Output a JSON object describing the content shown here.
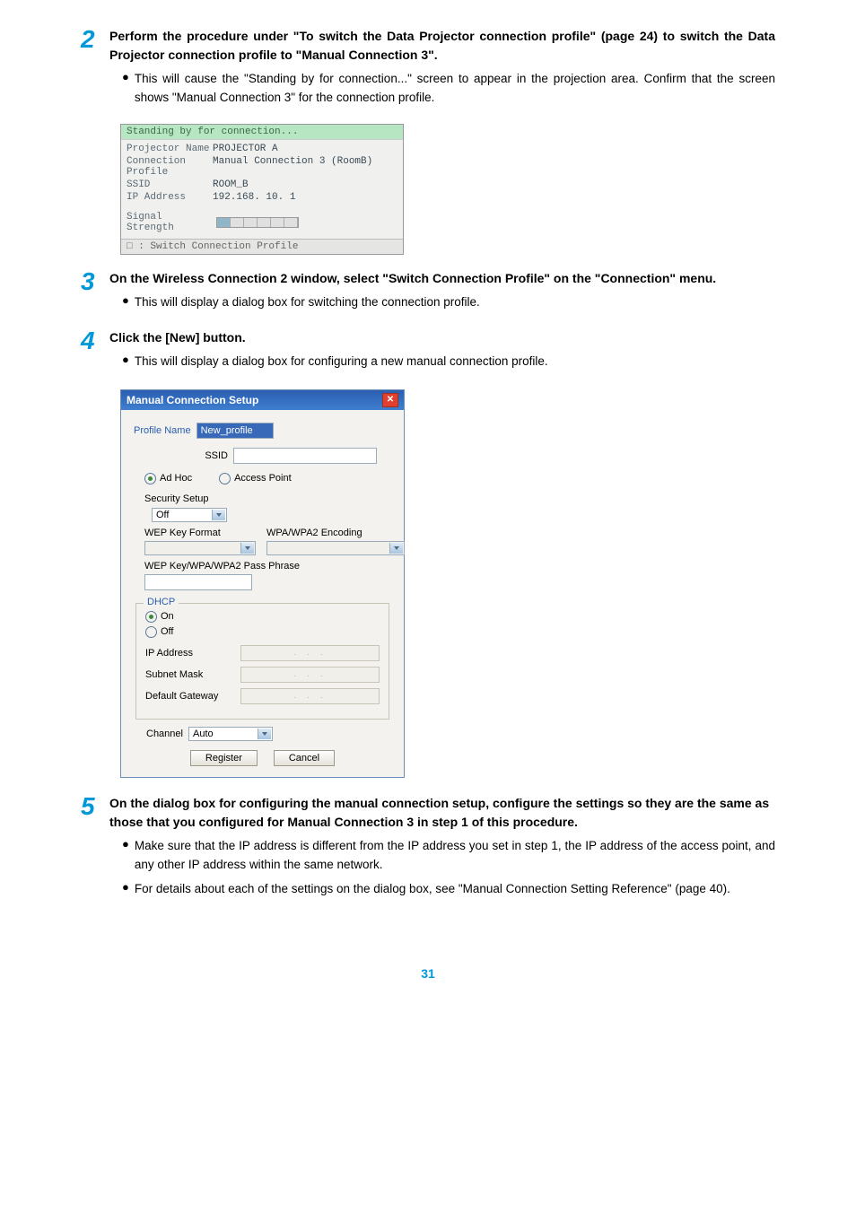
{
  "steps": {
    "s2": {
      "num": "2",
      "heading": "Perform the procedure under \"To switch the Data Projector connection profile\" (page 24) to switch the Data Projector connection profile to \"Manual Connection 3\".",
      "bullets": [
        "This will cause the \"Standing by for connection...\" screen to appear in the projection area. Confirm that the screen shows \"Manual Connection 3\" for the connection profile."
      ]
    },
    "s3": {
      "num": "3",
      "heading": "On the Wireless Connection 2 window, select \"Switch Connection Profile\" on the \"Connection\" menu.",
      "bullets": [
        "This will display a dialog box for switching the connection profile."
      ]
    },
    "s4": {
      "num": "4",
      "heading": "Click the [New] button.",
      "bullets": [
        "This will display a dialog box for configuring a new manual connection profile."
      ]
    },
    "s5": {
      "num": "5",
      "heading": "On the dialog box for configuring the manual connection setup, configure the settings so they are the same as those that you configured for Manual Connection 3 in step 1 of this procedure.",
      "bullets": [
        "Make sure that the IP address is different from the IP address you set in step 1, the IP address of the access point, and any other IP address within the same network.",
        "For details about each of the settings on the dialog box, see \"Manual Connection Setting Reference\" (page 40)."
      ]
    }
  },
  "proj": {
    "title": "Standing by for connection...",
    "rows": [
      {
        "label": "Projector Name",
        "value": "PROJECTOR A"
      },
      {
        "label": "Connection Profile",
        "value": "Manual Connection 3 (RoomB)"
      },
      {
        "label": "SSID",
        "value": "ROOM_B"
      },
      {
        "label": "IP Address",
        "value": "192.168. 10.  1"
      }
    ],
    "signal_label": "Signal Strength",
    "footer": "□ : Switch Connection Profile"
  },
  "dlg": {
    "title": "Manual Connection Setup",
    "profile_name_label": "Profile Name",
    "profile_name_value": "New_profile",
    "ssid_label": "SSID",
    "mode_adhoc": "Ad Hoc",
    "mode_ap": "Access Point",
    "security_label": "Security Setup",
    "security_value": "Off",
    "wep_label": "WEP Key Format",
    "wpa_label": "WPA/WPA2 Encoding",
    "pass_label": "WEP Key/WPA/WPA2 Pass Phrase",
    "dhcp_label": "DHCP",
    "dhcp_on": "On",
    "dhcp_off": "Off",
    "ip_label": "IP Address",
    "subnet_label": "Subnet Mask",
    "gateway_label": "Default Gateway",
    "channel_label": "Channel",
    "channel_value": "Auto",
    "register_btn": "Register",
    "cancel_btn": "Cancel"
  },
  "page_number": "31"
}
